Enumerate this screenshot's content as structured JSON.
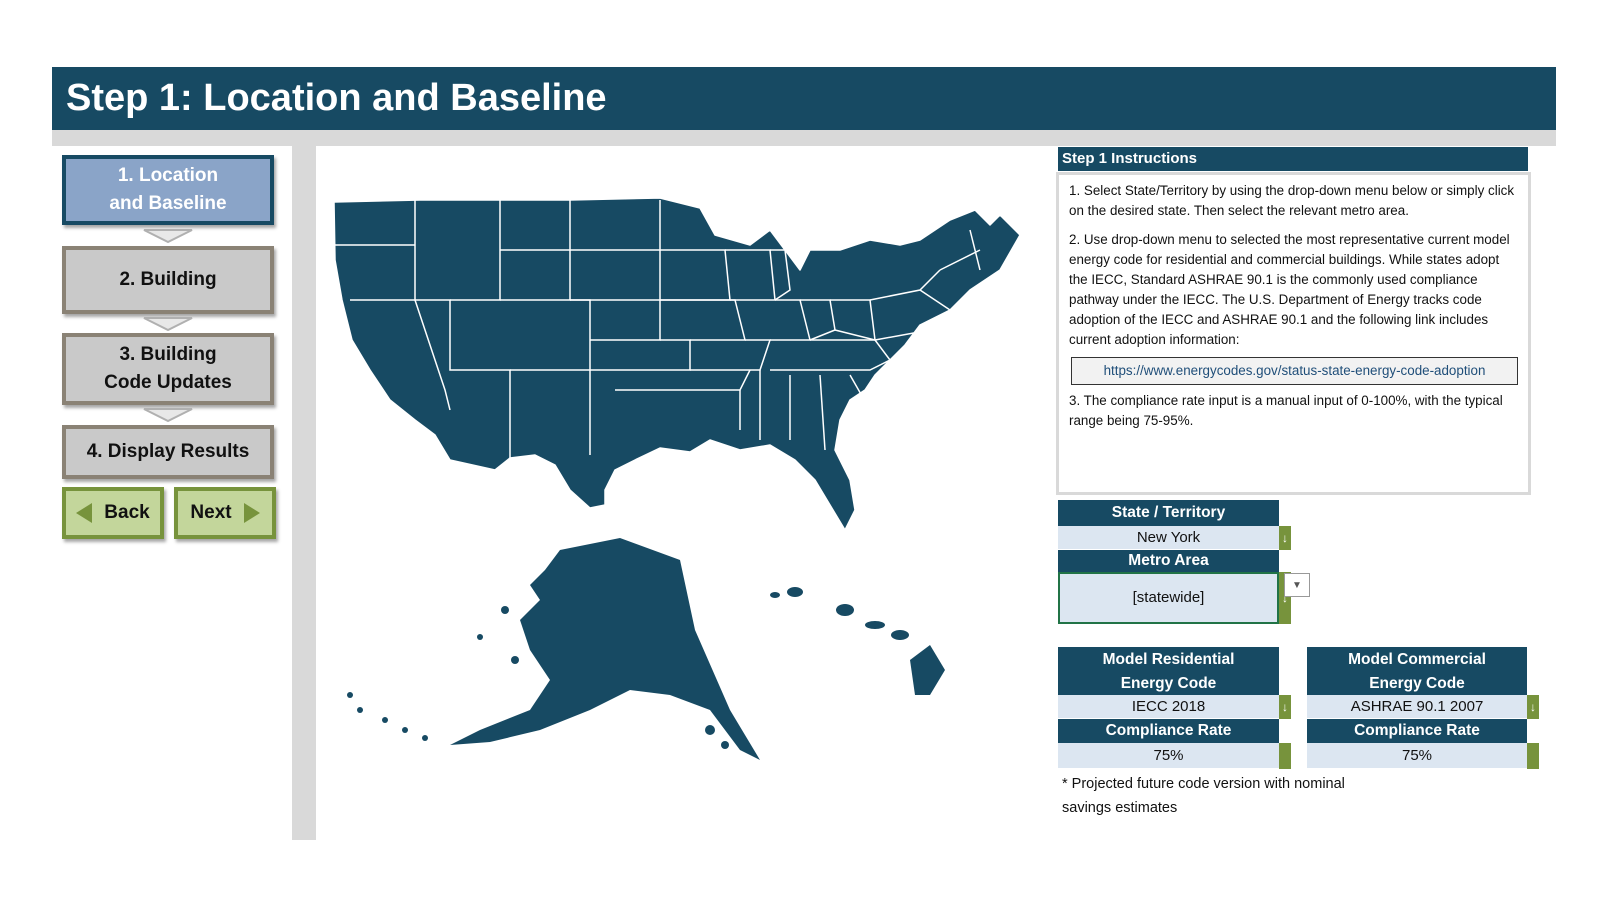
{
  "header": {
    "title": "Step 1: Location and Baseline"
  },
  "nav": {
    "items": [
      {
        "label_line1": "1. Location",
        "label_line2": "and Baseline"
      },
      {
        "label_line1": "2. Building",
        "label_line2": ""
      },
      {
        "label_line1": "3. Building",
        "label_line2": "Code Updates"
      },
      {
        "label_line1": "4. Display Results",
        "label_line2": ""
      }
    ],
    "back_label": "Back",
    "next_label": "Next"
  },
  "instructions": {
    "title": "Step 1 Instructions",
    "p1": "1. Select State/Territory by using the drop-down menu below or simply click on the desired state. Then select the relevant metro area.",
    "p2": "2. Use drop-down menu to selected the most representative current model energy code for residential and commercial buildings. While states adopt the IECC, Standard ASHRAE 90.1 is the commonly used compliance pathway under the IECC. The U.S. Department of Energy tracks code adoption of the IECC and ASHRAE 90.1 and the following link includes current adoption information:",
    "link": "https://www.energycodes.gov/status-state-energy-code-adoption",
    "p3": "3. The compliance rate input is a manual input of 0-100%, with the typical range being 75-95%."
  },
  "form": {
    "state_label": "State / Territory",
    "state_value": "New York",
    "metro_label": "Metro Area",
    "metro_value": "[statewide]",
    "res_label_1": "Model Residential",
    "res_label_2": "Energy Code",
    "res_value": "IECC 2018",
    "com_label_1": "Model Commercial",
    "com_label_2": "Energy Code",
    "com_value": "ASHRAE 90.1 2007",
    "res_rate_label": "Compliance Rate",
    "res_rate_value": "75%",
    "com_rate_label": "Compliance Rate",
    "com_rate_value": "75%",
    "dropdown_glyph": "↓",
    "note_line1": "* Projected future code version with nominal",
    "note_line2": "savings estimates"
  },
  "colors": {
    "navy": "#174a63",
    "green_border": "#77933c",
    "green_fill": "#c3d69b",
    "gray": "#c9c9c9",
    "light_blue": "#dce6f1"
  }
}
